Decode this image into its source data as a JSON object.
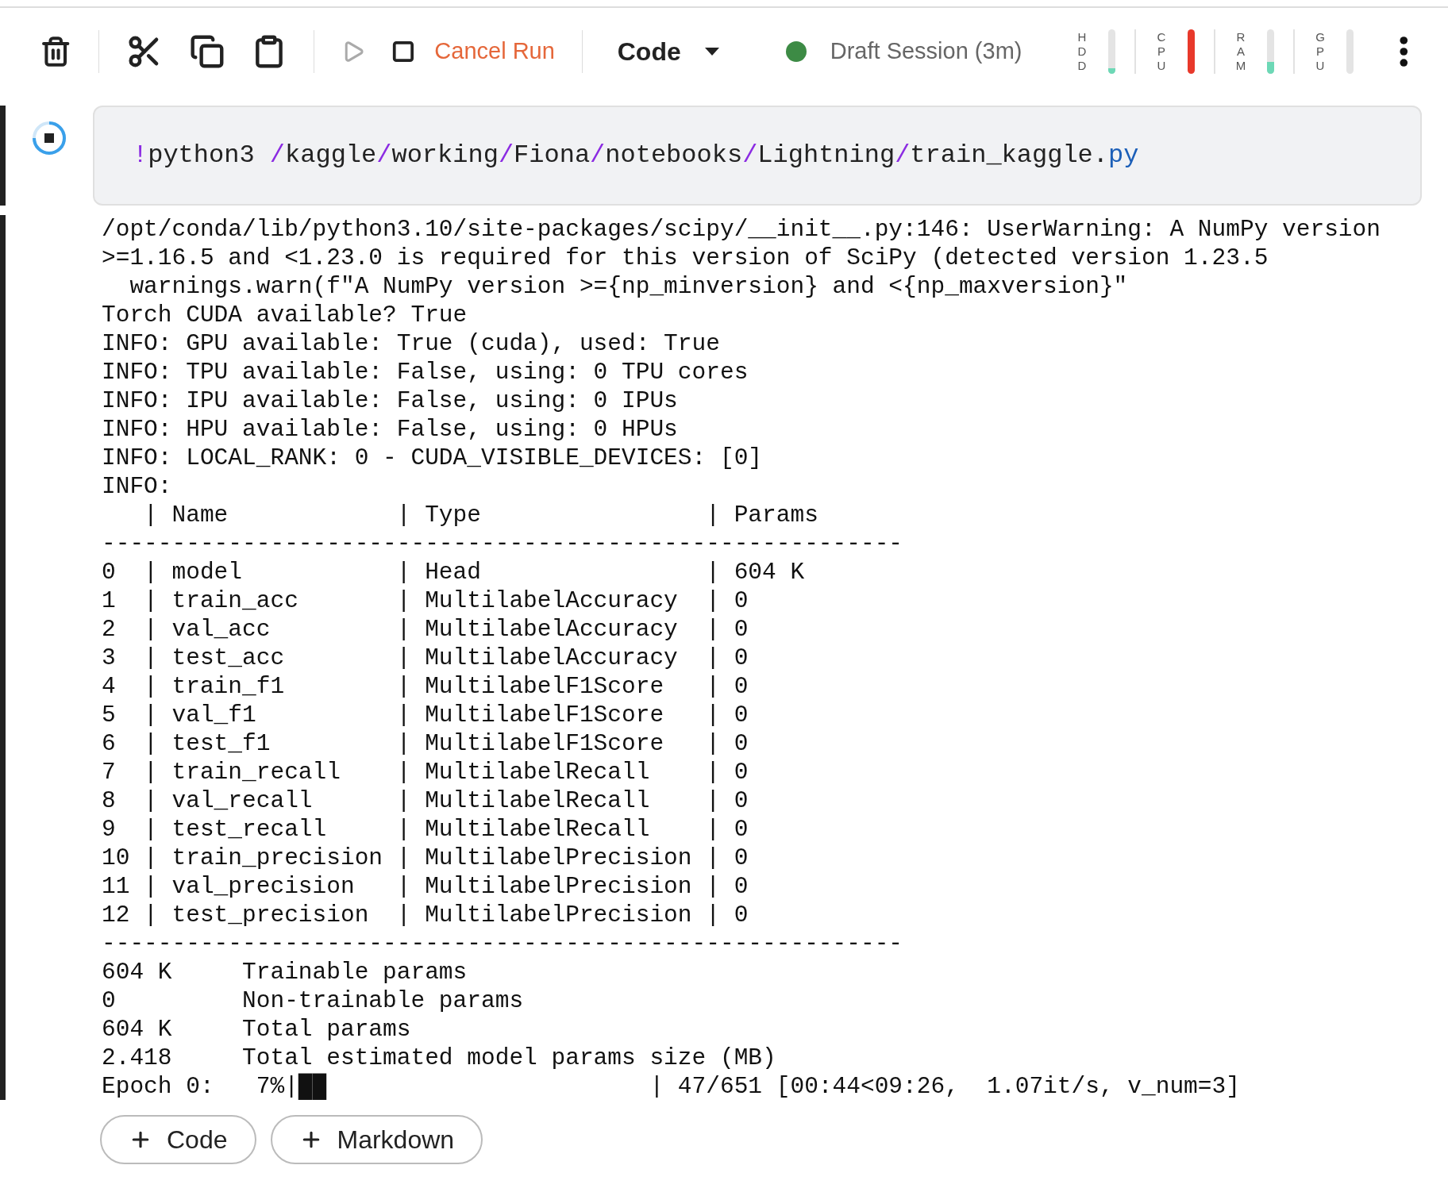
{
  "toolbar": {
    "cancel_label": "Cancel Run",
    "run_disabled": true,
    "cell_type": "Code",
    "session": {
      "label": "Draft Session (3m)",
      "color": "#3d8b45"
    },
    "meters": [
      {
        "label": "HDD",
        "level": 0.12,
        "color": "#6dd8b6"
      },
      {
        "label": "CPU",
        "level": 1,
        "color": "#e8392b"
      },
      {
        "label": "RAM",
        "level": 0.26,
        "color": "#6dd8b6"
      },
      {
        "label": "GPU",
        "level": 0
      }
    ]
  },
  "cell": {
    "running": true,
    "code": [
      {
        "text": "!",
        "kind": "operator"
      },
      {
        "text": "python3 ",
        "kind": "plain"
      },
      {
        "text": "/",
        "kind": "operator"
      },
      {
        "text": "kaggle",
        "kind": "plain"
      },
      {
        "text": "/",
        "kind": "operator"
      },
      {
        "text": "working",
        "kind": "plain"
      },
      {
        "text": "/",
        "kind": "operator"
      },
      {
        "text": "Fiona",
        "kind": "plain"
      },
      {
        "text": "/",
        "kind": "operator"
      },
      {
        "text": "notebooks",
        "kind": "plain"
      },
      {
        "text": "/",
        "kind": "operator"
      },
      {
        "text": "Lightning",
        "kind": "plain"
      },
      {
        "text": "/",
        "kind": "operator"
      },
      {
        "text": "train_kaggle",
        "kind": "plain"
      },
      {
        "text": ".",
        "kind": "plain"
      },
      {
        "text": "py",
        "kind": "attribute"
      }
    ],
    "output": [
      "/opt/conda/lib/python3.10/site-packages/scipy/__init__.py:146: UserWarning: A NumPy version",
      ">=1.16.5 and <1.23.0 is required for this version of SciPy (detected version 1.23.5",
      "  warnings.warn(f\"A NumPy version >={np_minversion} and <{np_maxversion}\"",
      "Torch CUDA available? True",
      "INFO: GPU available: True (cuda), used: True",
      "INFO: TPU available: False, using: 0 TPU cores",
      "INFO: IPU available: False, using: 0 IPUs",
      "INFO: HPU available: False, using: 0 HPUs",
      "INFO: LOCAL_RANK: 0 - CUDA_VISIBLE_DEVICES: [0]",
      "INFO: ",
      "   | Name            | Type                | Params",
      "---------------------------------------------------------",
      "0  | model           | Head                | 604 K",
      "1  | train_acc       | MultilabelAccuracy  | 0",
      "2  | val_acc         | MultilabelAccuracy  | 0",
      "3  | test_acc        | MultilabelAccuracy  | 0",
      "4  | train_f1        | MultilabelF1Score   | 0",
      "5  | val_f1          | MultilabelF1Score   | 0",
      "6  | test_f1         | MultilabelF1Score   | 0",
      "7  | train_recall    | MultilabelRecall    | 0",
      "8  | val_recall      | MultilabelRecall    | 0",
      "9  | test_recall     | MultilabelRecall    | 0",
      "10 | train_precision | MultilabelPrecision | 0",
      "11 | val_precision   | MultilabelPrecision | 0",
      "12 | test_precision  | MultilabelPrecision | 0",
      "---------------------------------------------------------",
      "604 K     Trainable params",
      "0         Non-trainable params",
      "604 K     Total params",
      "2.418     Total estimated model params size (MB)",
      "Epoch 0:   7%|██                       | 47/651 [00:44<09:26,  1.07it/s, v_num=3]"
    ]
  },
  "add_buttons": [
    "Code",
    "Markdown"
  ]
}
